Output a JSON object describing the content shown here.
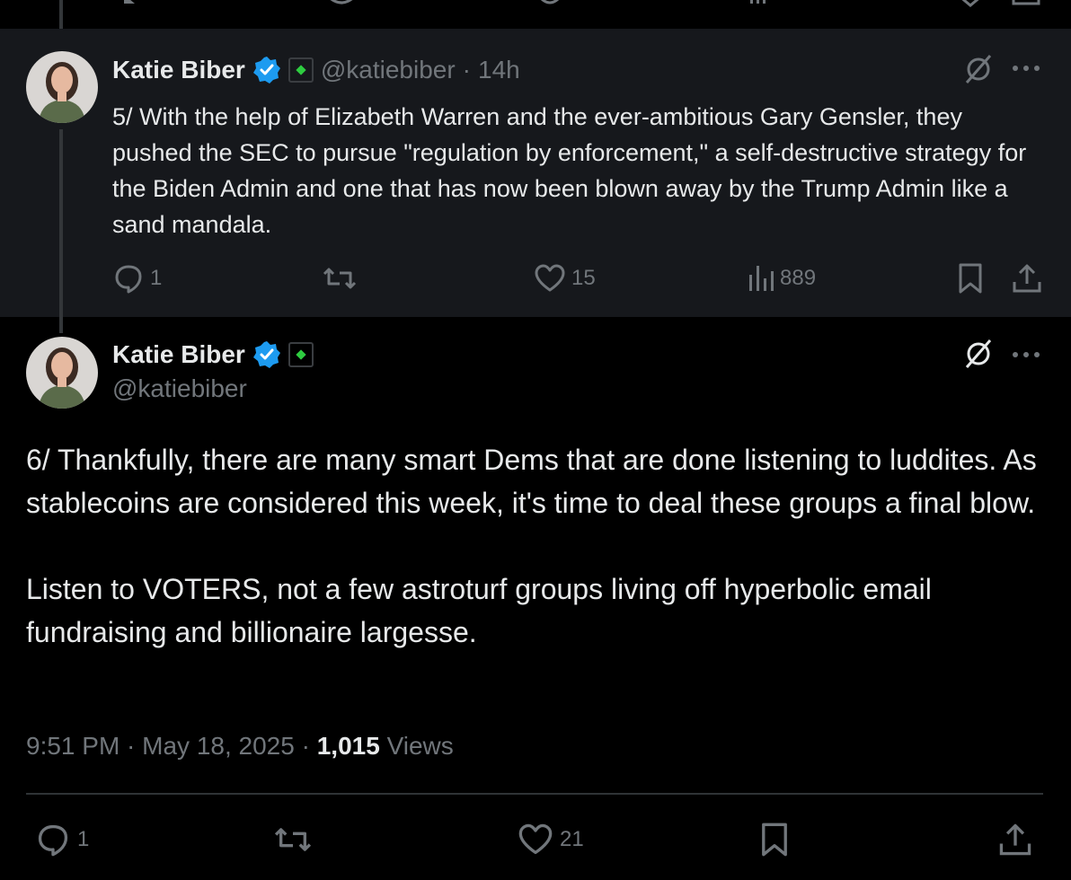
{
  "tweet5": {
    "author_name": "Katie Biber",
    "handle": "@katiebiber",
    "separator": "·",
    "time_ago": "14h",
    "text": "5/ With the help of Elizabeth Warren and the ever-ambitious Gary Gensler, they pushed the SEC to pursue \"regulation by enforcement,\" a self-destructive strategy for the Biden Admin and one that has now been blown away by the Trump Admin like a sand mandala.",
    "replies": "1",
    "likes": "15",
    "views": "889"
  },
  "tweet6": {
    "author_name": "Katie Biber",
    "handle": "@katiebiber",
    "paragraph1": "6/ Thankfully, there are many smart Dems that are done listening to luddites. As stablecoins are considered this week, it's time to deal these groups a final blow.",
    "paragraph2": "Listen to VOTERS, not a few astroturf groups living off hyperbolic email fundraising and billionaire largesse.",
    "timestamp": "9:51 PM · May 18, 2025 · ",
    "views_count": "1,015",
    "views_label": " Views",
    "replies": "1",
    "likes": "21"
  },
  "icons": {
    "verified": "verified-badge-icon",
    "affiliation": "government-affiliation-icon",
    "grok": "grok-icon",
    "more": "more-icon",
    "reply": "reply-icon",
    "repost": "repost-icon",
    "like": "like-icon",
    "views": "views-icon",
    "bookmark": "bookmark-icon",
    "share": "share-icon"
  },
  "colors": {
    "background": "#000000",
    "highlight_background": "#16181c",
    "text": "#e7e9ea",
    "muted": "#71767b",
    "verified_blue": "#1d9bf0"
  }
}
